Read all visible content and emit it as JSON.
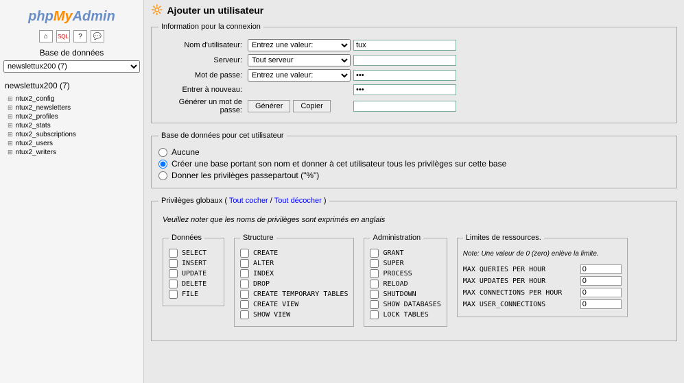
{
  "logo": {
    "php": "php",
    "my": "My",
    "admin": "Admin"
  },
  "sidebar": {
    "db_label": "Base de données",
    "db_selected": "newslettux200 (7)",
    "db_name": "newslettux200 (7)",
    "tables": [
      "ntux2_config",
      "ntux2_newsletters",
      "ntux2_profiles",
      "ntux2_stats",
      "ntux2_subscriptions",
      "ntux2_users",
      "ntux2_writers"
    ]
  },
  "page": {
    "title": "Ajouter un utilisateur"
  },
  "conn": {
    "legend": "Information pour la connexion",
    "username_label": "Nom d'utilisateur:",
    "username_select": "Entrez une valeur:",
    "username_value": "tux",
    "host_label": "Serveur:",
    "host_select": "Tout serveur",
    "host_value": "",
    "password_label": "Mot de passe:",
    "password_select": "Entrez une valeur:",
    "password_value": "***",
    "retype_label": "Entrer à nouveau:",
    "retype_value": "***",
    "generate_label": "Générer un mot de passe:",
    "generate_btn": "Générer",
    "copy_btn": "Copier",
    "generate_value": ""
  },
  "userdb": {
    "legend": "Base de données pour cet utilisateur",
    "none": "Aucune",
    "create": "Créer une base portant son nom et donner à cet utilisateur tous les privilèges sur cette base",
    "wildcard": "Donner les privilèges passepartout (\"%\")"
  },
  "priv": {
    "legend_prefix": "Privilèges globaux",
    "check_all": "Tout cocher",
    "uncheck_all": "Tout décocher",
    "note": "Veuillez noter que les noms de privilèges sont exprimés en anglais",
    "data": {
      "legend": "Données",
      "items": [
        "SELECT",
        "INSERT",
        "UPDATE",
        "DELETE",
        "FILE"
      ]
    },
    "structure": {
      "legend": "Structure",
      "items": [
        "CREATE",
        "ALTER",
        "INDEX",
        "DROP",
        "CREATE TEMPORARY TABLES",
        "CREATE VIEW",
        "SHOW VIEW"
      ]
    },
    "admin": {
      "legend": "Administration",
      "items": [
        "GRANT",
        "SUPER",
        "PROCESS",
        "RELOAD",
        "SHUTDOWN",
        "SHOW DATABASES",
        "LOCK TABLES"
      ]
    },
    "limits": {
      "legend": "Limites de ressources.",
      "note": "Note: Une valeur de 0 (zero) enlève la limite.",
      "rows": [
        {
          "label": "MAX QUERIES PER HOUR",
          "value": "0"
        },
        {
          "label": "MAX UPDATES PER HOUR",
          "value": "0"
        },
        {
          "label": "MAX CONNECTIONS PER HOUR",
          "value": "0"
        },
        {
          "label": "MAX USER_CONNECTIONS",
          "value": "0"
        }
      ]
    }
  }
}
